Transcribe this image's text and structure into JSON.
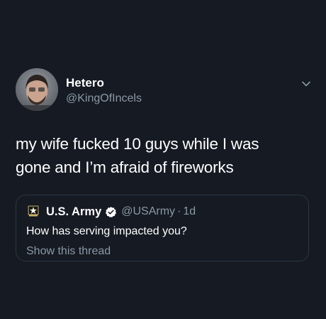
{
  "tweet": {
    "author": {
      "display_name": "Hetero",
      "handle": "@KingOfIncels"
    },
    "text_line_1": "my wife fucked 10 guys while I was",
    "text_line_2": "gone and I’m afraid of fireworks",
    "icons": {
      "more": "chevron-down-icon"
    }
  },
  "quoted_tweet": {
    "display_name": "U.S. Army",
    "verified": true,
    "handle": "@USArmy",
    "separator": "·",
    "time": "1d",
    "text": "How has serving impacted you?",
    "show_thread": "Show this thread",
    "icons": {
      "avatar": "army-star-logo-icon",
      "verified": "verified-badge-icon"
    }
  },
  "colors": {
    "background": "#151a23",
    "primary_text": "#ffffff",
    "secondary_text": "#8b98a5",
    "card_border": "#2f3640"
  }
}
